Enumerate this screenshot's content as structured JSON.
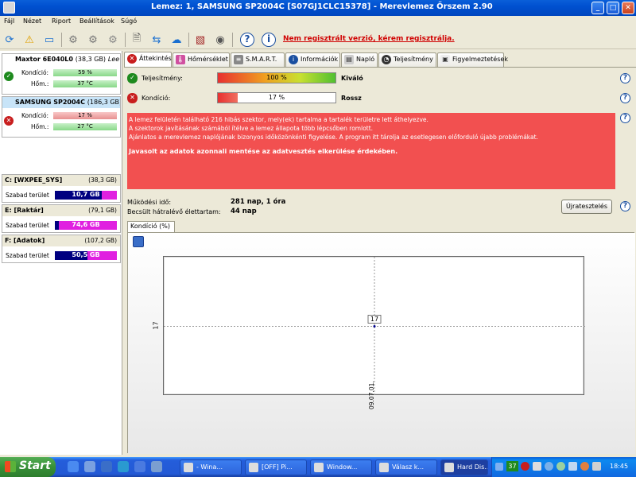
{
  "window": {
    "title": "Lemez: 1, SAMSUNG SP2004C [S07GJ1CLC15378]  -  Merevlemez Őrszem 2.90"
  },
  "menu": [
    "Fájl",
    "Nézet",
    "Riport",
    "Beállítások",
    "Súgó"
  ],
  "toolbar": {
    "register_link": "Nem regisztrált verzió, kérem regisztrálja."
  },
  "disks": [
    {
      "name": "Maxtor 6E040L0",
      "size": "(38,3 GB)",
      "extra": "Lee",
      "condition_label": "Kondíció:",
      "condition": "59 %",
      "condition_value": 59,
      "temp_label": "Hőm.:",
      "temp": "37 °C",
      "status": "ok"
    },
    {
      "name": "SAMSUNG SP2004C",
      "size": "(186,3 GB)",
      "condition_label": "Kondíció:",
      "condition": "17 %",
      "condition_value": 17,
      "temp_label": "Hőm.:",
      "temp": "27 °C",
      "status": "bad"
    }
  ],
  "partitions": [
    {
      "name": "C: [WXPEE_SYS]",
      "size": "(38,3 GB)",
      "free_label": "Szabad terület",
      "free": "10,7 GB",
      "free_fraction": 0.28
    },
    {
      "name": "E: [Raktár]",
      "size": "(79,1 GB)",
      "free_label": "Szabad terület",
      "free": "74,6 GB",
      "free_fraction": 0.94
    },
    {
      "name": "F: [Adatok]",
      "size": "(107,2 GB)",
      "free_label": "Szabad terület",
      "free": "50,5 GB",
      "free_fraction": 0.47
    }
  ],
  "tabs": [
    "Áttekintés",
    "Hőmérséklet",
    "S.M.A.R.T.",
    "Információk",
    "Napló",
    "Teljesítmény",
    "Figyelmeztetések"
  ],
  "overview": {
    "performance_label": "Teljesítmény:",
    "performance_value": "100 %",
    "performance_fraction": 1.0,
    "performance_rating": "Kiváló",
    "condition_label": "Kondíció:",
    "condition_value": "17 %",
    "condition_fraction": 0.17,
    "condition_rating": "Rossz",
    "alert_lines": [
      "A lemez felületén található 216 hibás szektor, mely(ek) tartalma a tartalék területre lett áthelyezve.",
      "A szektorok javításának számából ítélve a lemez állapota több lépcsőben romlott.",
      "Ajánlatos a merevlemez naplójának bizonyos időközönkénti figyelése. A program itt tárolja az esetlegesen előforduló újabb problémákat."
    ],
    "alert_bold": "Javasolt az adatok azonnali mentése az adatvesztés elkerülése érdekében.",
    "uptime_label": "Működési idő:",
    "uptime_value": "281 nap, 1 óra",
    "remaining_label": "Becsült hátralévő élettartam:",
    "remaining_value": "44 nap",
    "retest_button": "Újratesztelés"
  },
  "chart_data": {
    "type": "line",
    "tab_label": "Kondíció  (%)",
    "x": [
      "09.07.01."
    ],
    "values": [
      17
    ],
    "point_labels": [
      "17"
    ],
    "ytick_labels": [
      "17"
    ]
  },
  "taskbar": {
    "start": "Start",
    "tasks": [
      "- Wina...",
      "[OFF] Pi...",
      "Window...",
      "Válasz k...",
      "Hard Dis..."
    ],
    "tray_badge": "37",
    "clock": "18:45"
  }
}
